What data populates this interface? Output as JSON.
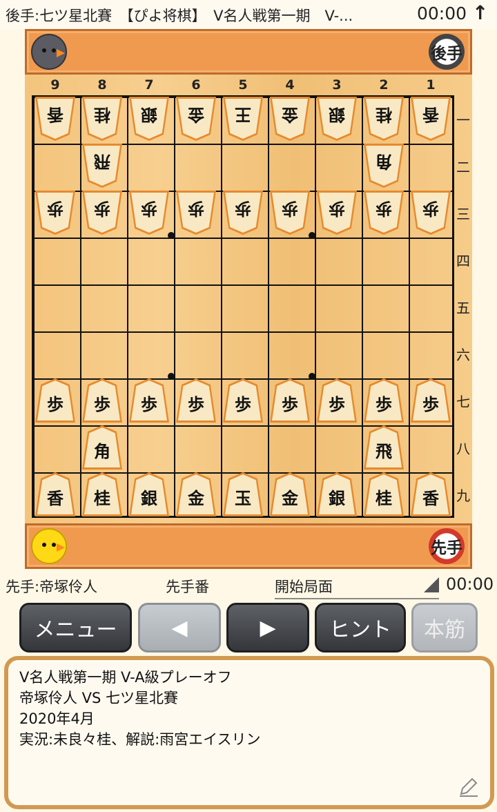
{
  "top": {
    "title": "後手:七ツ星北賽　【ぴよ将棋】　V名人戦第一期　V-...",
    "clock": "00:00",
    "arrow": "↑"
  },
  "gote_stand": {
    "badge": "後手"
  },
  "sente_stand": {
    "badge": "先手"
  },
  "board": {
    "files": [
      "9",
      "8",
      "7",
      "6",
      "5",
      "4",
      "3",
      "2",
      "1"
    ],
    "ranks": [
      "一",
      "二",
      "三",
      "四",
      "五",
      "六",
      "七",
      "八",
      "九"
    ],
    "pieces": [
      {
        "file": 9,
        "rank": 1,
        "ch": "香",
        "side": "gote"
      },
      {
        "file": 8,
        "rank": 1,
        "ch": "桂",
        "side": "gote"
      },
      {
        "file": 7,
        "rank": 1,
        "ch": "銀",
        "side": "gote"
      },
      {
        "file": 6,
        "rank": 1,
        "ch": "金",
        "side": "gote"
      },
      {
        "file": 5,
        "rank": 1,
        "ch": "王",
        "side": "gote"
      },
      {
        "file": 4,
        "rank": 1,
        "ch": "金",
        "side": "gote"
      },
      {
        "file": 3,
        "rank": 1,
        "ch": "銀",
        "side": "gote"
      },
      {
        "file": 2,
        "rank": 1,
        "ch": "桂",
        "side": "gote"
      },
      {
        "file": 1,
        "rank": 1,
        "ch": "香",
        "side": "gote"
      },
      {
        "file": 8,
        "rank": 2,
        "ch": "飛",
        "side": "gote"
      },
      {
        "file": 2,
        "rank": 2,
        "ch": "角",
        "side": "gote"
      },
      {
        "file": 9,
        "rank": 3,
        "ch": "歩",
        "side": "gote"
      },
      {
        "file": 8,
        "rank": 3,
        "ch": "歩",
        "side": "gote"
      },
      {
        "file": 7,
        "rank": 3,
        "ch": "歩",
        "side": "gote"
      },
      {
        "file": 6,
        "rank": 3,
        "ch": "歩",
        "side": "gote"
      },
      {
        "file": 5,
        "rank": 3,
        "ch": "歩",
        "side": "gote"
      },
      {
        "file": 4,
        "rank": 3,
        "ch": "歩",
        "side": "gote"
      },
      {
        "file": 3,
        "rank": 3,
        "ch": "歩",
        "side": "gote"
      },
      {
        "file": 2,
        "rank": 3,
        "ch": "歩",
        "side": "gote"
      },
      {
        "file": 1,
        "rank": 3,
        "ch": "歩",
        "side": "gote"
      },
      {
        "file": 9,
        "rank": 7,
        "ch": "歩",
        "side": "sente"
      },
      {
        "file": 8,
        "rank": 7,
        "ch": "歩",
        "side": "sente"
      },
      {
        "file": 7,
        "rank": 7,
        "ch": "歩",
        "side": "sente"
      },
      {
        "file": 6,
        "rank": 7,
        "ch": "歩",
        "side": "sente"
      },
      {
        "file": 5,
        "rank": 7,
        "ch": "歩",
        "side": "sente"
      },
      {
        "file": 4,
        "rank": 7,
        "ch": "歩",
        "side": "sente"
      },
      {
        "file": 3,
        "rank": 7,
        "ch": "歩",
        "side": "sente"
      },
      {
        "file": 2,
        "rank": 7,
        "ch": "歩",
        "side": "sente"
      },
      {
        "file": 1,
        "rank": 7,
        "ch": "歩",
        "side": "sente"
      },
      {
        "file": 8,
        "rank": 8,
        "ch": "角",
        "side": "sente"
      },
      {
        "file": 2,
        "rank": 8,
        "ch": "飛",
        "side": "sente"
      },
      {
        "file": 9,
        "rank": 9,
        "ch": "香",
        "side": "sente"
      },
      {
        "file": 8,
        "rank": 9,
        "ch": "桂",
        "side": "sente"
      },
      {
        "file": 7,
        "rank": 9,
        "ch": "銀",
        "side": "sente"
      },
      {
        "file": 6,
        "rank": 9,
        "ch": "金",
        "side": "sente"
      },
      {
        "file": 5,
        "rank": 9,
        "ch": "玉",
        "side": "sente"
      },
      {
        "file": 4,
        "rank": 9,
        "ch": "金",
        "side": "sente"
      },
      {
        "file": 3,
        "rank": 9,
        "ch": "銀",
        "side": "sente"
      },
      {
        "file": 2,
        "rank": 9,
        "ch": "桂",
        "side": "sente"
      },
      {
        "file": 1,
        "rank": 9,
        "ch": "香",
        "side": "sente"
      }
    ]
  },
  "info": {
    "sente_name": "先手:帝塚伶人",
    "turn": "先手番",
    "position": "開始局面",
    "clock": "00:00"
  },
  "buttons": {
    "menu": "メニュー",
    "back": "◀",
    "forward": "▶",
    "hint": "ヒント",
    "mainline": "本筋"
  },
  "panel": {
    "lines": [
      "V名人戦第一期 V-A級プレーオフ",
      "帝塚伶人 VS 七ツ星北賽",
      "2020年4月",
      "実況:未良々桂、解説:雨宮エイスリン"
    ]
  }
}
